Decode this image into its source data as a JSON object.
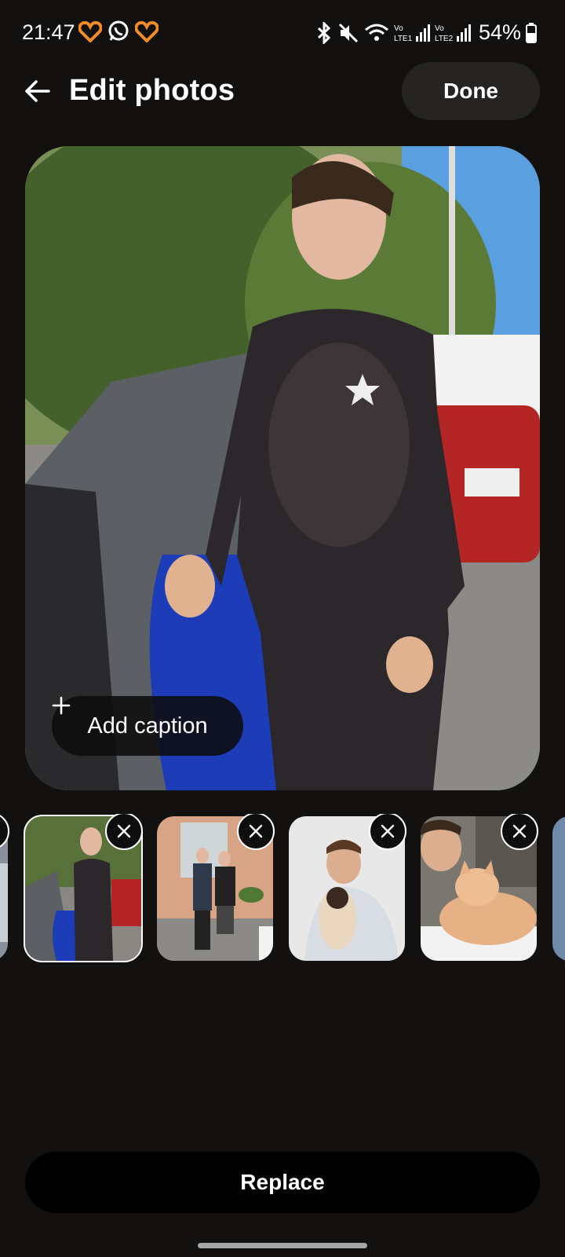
{
  "status_bar": {
    "time": "21:47",
    "battery": "54%",
    "network_1": "LTE1",
    "network_2": "LTE2",
    "icons": [
      "heart-icon",
      "whatsapp-icon",
      "heart-icon",
      "bluetooth-icon",
      "mute-icon",
      "wifi-icon",
      "signal-icon",
      "battery-icon"
    ]
  },
  "header": {
    "title": "Edit photos",
    "done_label": "Done"
  },
  "main_photo": {
    "caption_label": "Add caption",
    "caption_icon": "plus-icon"
  },
  "thumbnails": [
    {
      "selected": false,
      "partial": true
    },
    {
      "selected": true
    },
    {
      "selected": false
    },
    {
      "selected": false
    },
    {
      "selected": false
    }
  ],
  "footer": {
    "replace_label": "Replace"
  },
  "colors": {
    "background": "#121110",
    "button_dark": "#252422",
    "accent_orange": "#f28c28"
  }
}
